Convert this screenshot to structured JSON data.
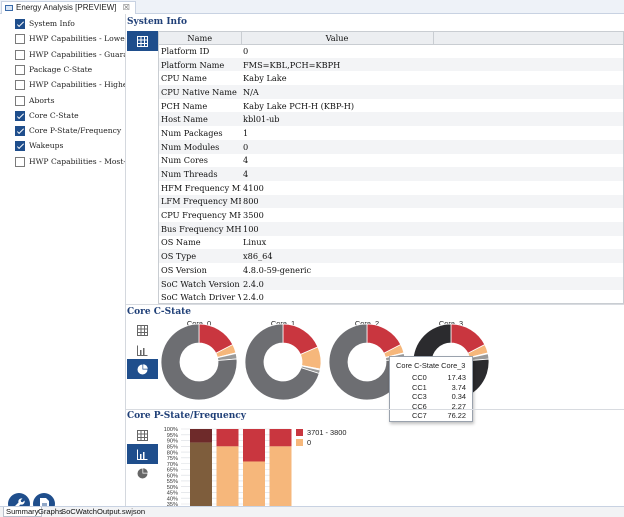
{
  "tab": {
    "title": "Energy Analysis [PREVIEW]",
    "close": "☒"
  },
  "checklist": [
    {
      "label": "System Info",
      "checked": true
    },
    {
      "label": "HWP Capabilities - Lowest-Perf",
      "checked": false
    },
    {
      "label": "HWP Capabilities - Guaranteed-",
      "checked": false
    },
    {
      "label": "Package C-State",
      "checked": false
    },
    {
      "label": "HWP Capabilities - Highest-Perf",
      "checked": false
    },
    {
      "label": "Aborts",
      "checked": false
    },
    {
      "label": "Core C-State",
      "checked": true
    },
    {
      "label": "Core P-State/Frequency",
      "checked": true
    },
    {
      "label": "Wakeups",
      "checked": true
    },
    {
      "label": "HWP Capabilities - Most-Efficie",
      "checked": false
    }
  ],
  "system_info": {
    "title": "System Info",
    "headers": [
      "Name",
      "Value"
    ],
    "rows": [
      [
        "Platform ID",
        "0"
      ],
      [
        "Platform Name",
        "FMS=KBL,PCH=KBPH"
      ],
      [
        "CPU Name",
        "Kaby Lake"
      ],
      [
        "CPU Native Name",
        "N/A"
      ],
      [
        "PCH Name",
        "Kaby Lake PCH-H (KBP-H)"
      ],
      [
        "Host Name",
        "kbl01-ub"
      ],
      [
        "Num Packages",
        "1"
      ],
      [
        "Num Modules",
        "0"
      ],
      [
        "Num Cores",
        "4"
      ],
      [
        "Num Threads",
        "4"
      ],
      [
        "HFM Frequency MHz",
        "4100"
      ],
      [
        "LFM Frequency MHz",
        "800"
      ],
      [
        "CPU Frequency MHz",
        "3500"
      ],
      [
        "Bus Frequency MHz",
        "100"
      ],
      [
        "OS Name",
        "Linux"
      ],
      [
        "OS Type",
        "x86_64"
      ],
      [
        "OS Version",
        "4.8.0-59-generic"
      ],
      [
        "SoC Watch Version",
        "2.4.0"
      ],
      [
        "SoC Watch Driver Ver...",
        "2.4.0"
      ]
    ]
  },
  "core_cstate": {
    "title": "Core C-State",
    "colors": {
      "CC0": "#c9363f",
      "CC1": "#f6b77b",
      "CC3": "#7d5a3a",
      "CC6": "#9a9a9a",
      "CC7": "#6d6e72"
    },
    "donuts": [
      {
        "label": "Core_0",
        "slices": [
          17.4,
          3.7,
          0.3,
          2.3,
          76.2
        ]
      },
      {
        "label": "Core_1",
        "slices": [
          18.5,
          9.5,
          0.4,
          1.5,
          70.1
        ]
      },
      {
        "label": "Core_2",
        "slices": [
          17.4,
          3.7,
          0.3,
          2.3,
          76.2
        ]
      },
      {
        "label": "Core_3",
        "slices": [
          17.43,
          3.74,
          0.34,
          2.27,
          76.22
        ]
      }
    ],
    "tooltip": {
      "title": "Core C-State Core_3",
      "rows": [
        [
          "CC0",
          "17.43"
        ],
        [
          "CC1",
          "3.74"
        ],
        [
          "CC3",
          "0.34"
        ],
        [
          "CC6",
          "2.27"
        ],
        [
          "CC7",
          "76.22"
        ]
      ]
    }
  },
  "pstate": {
    "title": "Core P-State/Frequency",
    "yticks": [
      "100%",
      "95%",
      "90%",
      "85%",
      "80%",
      "75%",
      "70%",
      "65%",
      "60%",
      "55%",
      "50%",
      "45%",
      "40%",
      "35%"
    ],
    "legend": [
      {
        "label": "3701 - 3800",
        "color": "#c9363f"
      },
      {
        "label": "0",
        "color": "#f6b77b"
      }
    ],
    "bars": [
      {
        "top": 14,
        "bottom": 86
      },
      {
        "top": 19,
        "bottom": 81
      },
      {
        "top": 39,
        "bottom": 61
      },
      {
        "top": 19,
        "bottom": 81
      }
    ]
  },
  "bottom_tabs": [
    "Summary",
    "Graphs",
    "SoCWatchOutput.swjson"
  ]
}
